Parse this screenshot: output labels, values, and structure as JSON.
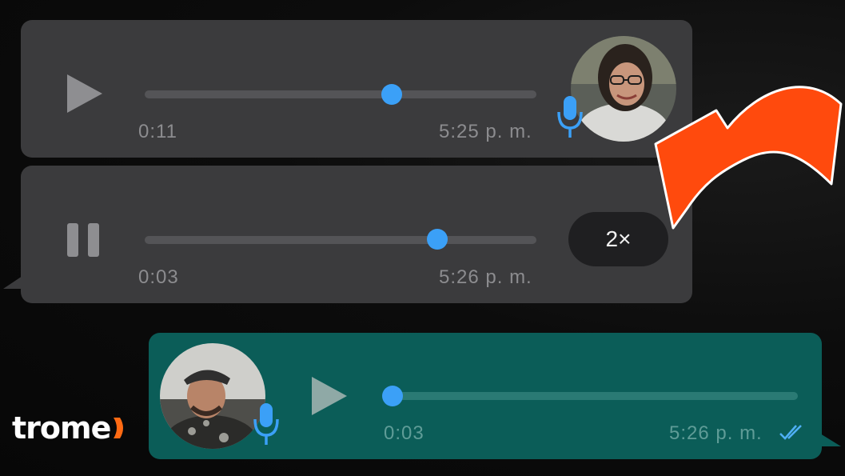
{
  "messages": [
    {
      "id": "voice-1",
      "state": "paused",
      "progress": 0.62,
      "elapsed": "0:11",
      "timestamp": "5:25 p. m.",
      "mic_icon": "mic-icon"
    },
    {
      "id": "voice-2",
      "state": "playing",
      "progress": 0.74,
      "elapsed": "0:03",
      "timestamp": "5:26 p. m.",
      "speed": "2×"
    },
    {
      "id": "voice-3",
      "state": "paused",
      "progress": 0.0,
      "elapsed": "0:03",
      "timestamp": "5:26 p. m.",
      "read_receipt_icon": "double-check-icon"
    }
  ],
  "colors": {
    "incoming_bubble": "#3b3b3d",
    "outgoing_bubble": "#0b5d58",
    "accent_blue": "#3ba0f7",
    "arrow_orange": "#ff4a0d"
  },
  "brand": {
    "logo_text": "trome"
  }
}
